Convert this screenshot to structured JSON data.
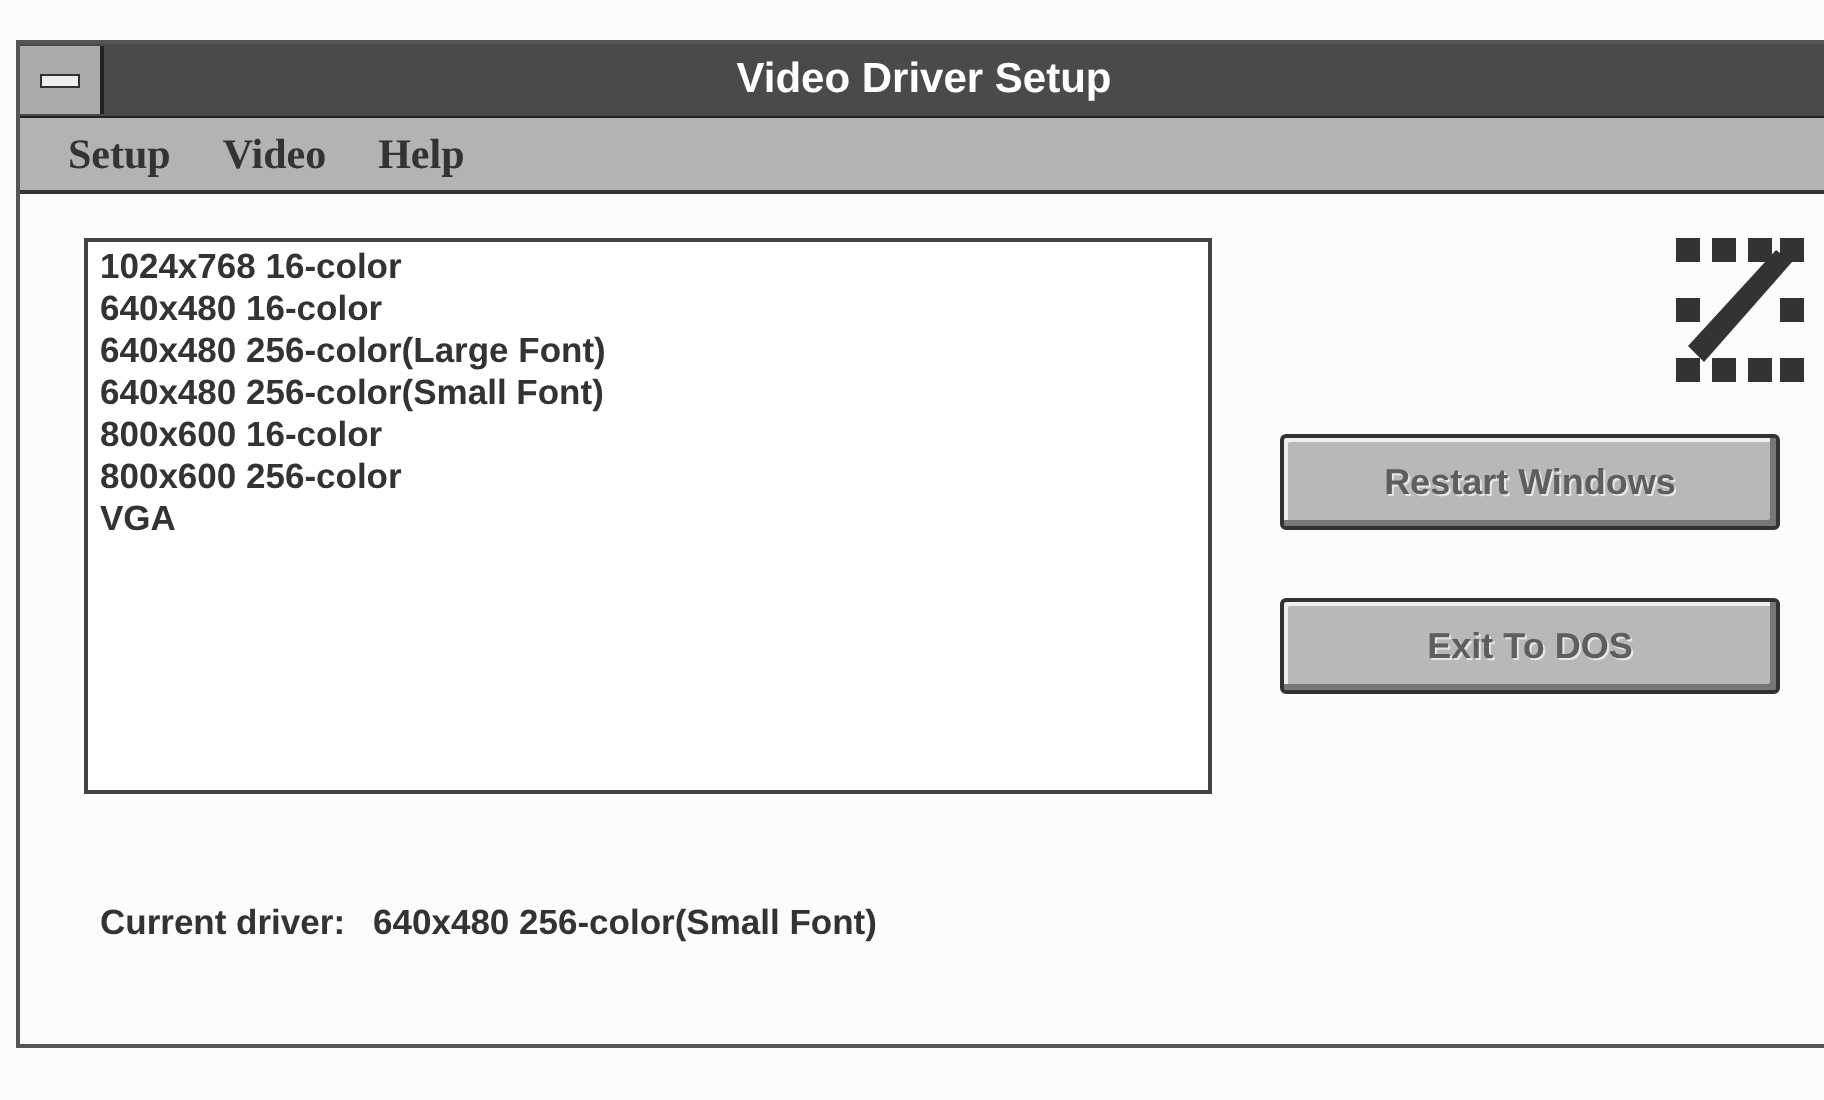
{
  "window": {
    "title": "Video Driver Setup"
  },
  "menu": [
    {
      "label": "Setup"
    },
    {
      "label": "Video"
    },
    {
      "label": "Help"
    }
  ],
  "drivers": [
    {
      "label": "1024x768 16-color",
      "selected": false
    },
    {
      "label": "640x480 16-color",
      "selected": false
    },
    {
      "label": "640x480 256-color(Large Font)",
      "selected": false
    },
    {
      "label": "640x480 256-color(Small Font)",
      "selected": false
    },
    {
      "label": "800x600 16-color",
      "selected": false
    },
    {
      "label": "800x600 256-color",
      "selected": false
    },
    {
      "label": "VGA",
      "selected": false
    }
  ],
  "buttons": [
    {
      "label": "Restart Windows",
      "disabled": true
    },
    {
      "label": "Exit To DOS",
      "disabled": true
    }
  ],
  "current_driver": {
    "label": "Current driver:",
    "value": "640x480 256-color(Small Font)"
  }
}
